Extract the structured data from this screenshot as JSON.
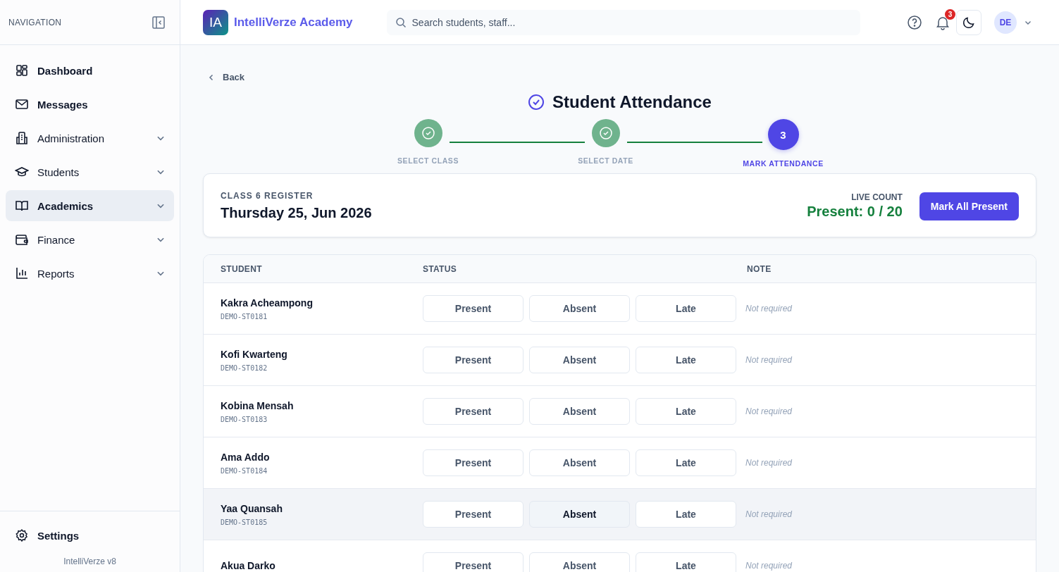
{
  "sidebar": {
    "heading": "NAVIGATION",
    "items": [
      {
        "kind": "link",
        "label": "Dashboard",
        "selected": false
      },
      {
        "kind": "link",
        "label": "Messages",
        "selected": false
      },
      {
        "kind": "group",
        "label": "Administration",
        "selected": false
      },
      {
        "kind": "group",
        "label": "Students",
        "selected": false
      },
      {
        "kind": "group",
        "label": "Academics",
        "selected": true
      },
      {
        "kind": "group",
        "label": "Finance",
        "selected": false
      },
      {
        "kind": "group",
        "label": "Reports",
        "selected": false
      }
    ],
    "settings": "Settings",
    "version": "IntelliVerze v8"
  },
  "header": {
    "logo": "IA",
    "brand": "IntelliVerze Academy",
    "search": {
      "placeholder": "Search students, staff..."
    },
    "notifications": "3",
    "avatar": "DE"
  },
  "back": "Back",
  "title": "Student Attendance",
  "steps": [
    {
      "label": "SELECT CLASS",
      "done": true,
      "current": false
    },
    {
      "label": "SELECT DATE",
      "done": true,
      "current": false
    },
    {
      "label": "MARK ATTENDANCE",
      "number": "3",
      "done": false,
      "current": true
    }
  ],
  "register": {
    "label": "CLASS 6 REGISTER",
    "date": "Thursday 25, Jun 2026",
    "count_label": "LIVE COUNT",
    "count": "Present: 0 / 20",
    "button": "Mark All Present"
  },
  "table": {
    "columns": [
      "STUDENT",
      "STATUS",
      "NOTE"
    ],
    "rows": [
      {
        "name": "Kakra Acheampong",
        "id": "DEMO-ST0181",
        "hovered": false,
        "options": [
          {
            "label": "Present",
            "hovered": false
          },
          {
            "label": "Absent",
            "hovered": false
          },
          {
            "label": "Late",
            "hovered": false
          }
        ],
        "note": {
          "placeholder": "Not required"
        }
      },
      {
        "name": "Kofi Kwarteng",
        "id": "DEMO-ST0182",
        "hovered": false,
        "options": [
          {
            "label": "Present",
            "hovered": false
          },
          {
            "label": "Absent",
            "hovered": false
          },
          {
            "label": "Late",
            "hovered": false
          }
        ],
        "note": {
          "placeholder": "Not required"
        }
      },
      {
        "name": "Kobina Mensah",
        "id": "DEMO-ST0183",
        "hovered": false,
        "options": [
          {
            "label": "Present",
            "hovered": false
          },
          {
            "label": "Absent",
            "hovered": false
          },
          {
            "label": "Late",
            "hovered": false
          }
        ],
        "note": {
          "placeholder": "Not required"
        }
      },
      {
        "name": "Ama Addo",
        "id": "DEMO-ST0184",
        "hovered": false,
        "options": [
          {
            "label": "Present",
            "hovered": false
          },
          {
            "label": "Absent",
            "hovered": false
          },
          {
            "label": "Late",
            "hovered": false
          }
        ],
        "note": {
          "placeholder": "Not required"
        }
      },
      {
        "name": "Yaa Quansah",
        "id": "DEMO-ST0185",
        "hovered": true,
        "options": [
          {
            "label": "Present",
            "hovered": false
          },
          {
            "label": "Absent",
            "hovered": true
          },
          {
            "label": "Late",
            "hovered": false
          }
        ],
        "note": {
          "placeholder": "Not required"
        }
      },
      {
        "name": "Akua Darko",
        "hovered": false,
        "options": [
          {
            "label": "Present",
            "hovered": false
          },
          {
            "label": "Absent",
            "hovered": false
          },
          {
            "label": "Late",
            "hovered": false
          }
        ],
        "note": {
          "placeholder": "Not required"
        }
      }
    ]
  }
}
